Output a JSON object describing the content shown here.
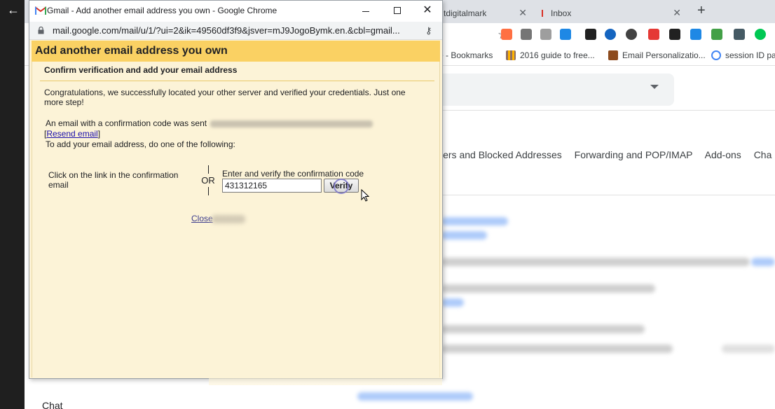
{
  "background": {
    "tabs": [
      {
        "label": "tdigitalmark"
      },
      {
        "label": "Inbox"
      }
    ],
    "new_tab_symbol": "+",
    "bookmarks": [
      {
        "label": "e - Bookmarks"
      },
      {
        "label": "2016 guide to free..."
      },
      {
        "label": "Email Personalizatio..."
      },
      {
        "label": "session ID par"
      }
    ],
    "settings_tabs": [
      {
        "label": "ilters and Blocked Addresses"
      },
      {
        "label": "Forwarding and POP/IMAP"
      },
      {
        "label": "Add-ons"
      },
      {
        "label": "Cha"
      }
    ],
    "sidebar_chat": "Chat"
  },
  "popup": {
    "window_title": "Gmail - Add another email address you own - Google Chrome",
    "url": "mail.google.com/mail/u/1/?ui=2&ik=49560df3f9&jsver=mJ9JogoBymk.en.&cbl=gmail...",
    "header": "Add another email address you own",
    "section_heading": "Confirm verification and add your email address",
    "congrats_text": "Congratulations, we successfully located your other server and verified your credentials. Just one more step!",
    "email_sent_text": "An email with a confirmation code was sent",
    "resend_link": "Resend email",
    "instruction_text": "To add your email address, do one of the following:",
    "option_left": "Click on the link in the confirmation email",
    "or_text": "OR",
    "option_right_label": "Enter and verify the confirmation code",
    "code_value": "431312165",
    "verify_button": "Verify",
    "close_link": "Close"
  },
  "colors": {
    "header_bg": "#fad163",
    "content_bg": "#fcf3d7",
    "link": "#1a0dab"
  }
}
